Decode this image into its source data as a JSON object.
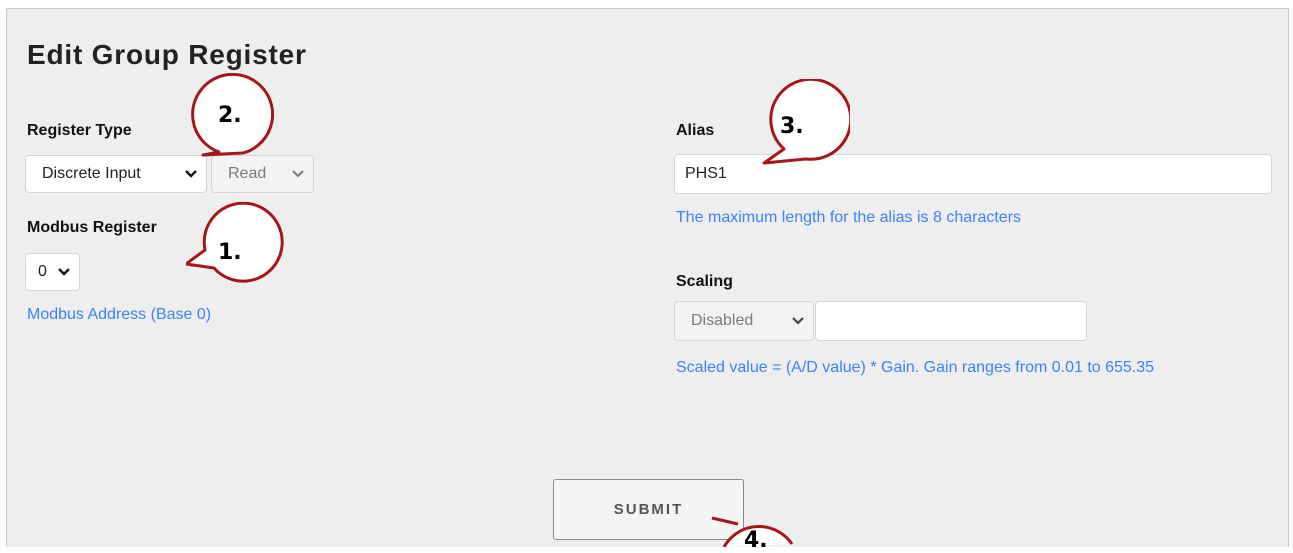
{
  "form": {
    "title": "Edit Group Register",
    "register_type": {
      "label": "Register Type",
      "type_value": "Discrete Input",
      "access_value": "Read"
    },
    "modbus_register": {
      "label": "Modbus Register",
      "value": "0",
      "hint": "Modbus Address (Base 0)"
    },
    "alias": {
      "label": "Alias",
      "value": "PHS1",
      "hint": "The maximum length for the alias is 8 characters"
    },
    "scaling": {
      "label": "Scaling",
      "mode_value": "Disabled",
      "gain_value": "",
      "hint": "Scaled value = (A/D value) * Gain. Gain ranges from 0.01 to 655.35"
    },
    "submit_label": "SUBMIT"
  },
  "callouts": [
    "1.",
    "2.",
    "3.",
    "4."
  ],
  "colors": {
    "panel_bg": "#eeeeee",
    "hint_blue": "#3b82f6",
    "callout_red": "#a3171c"
  }
}
